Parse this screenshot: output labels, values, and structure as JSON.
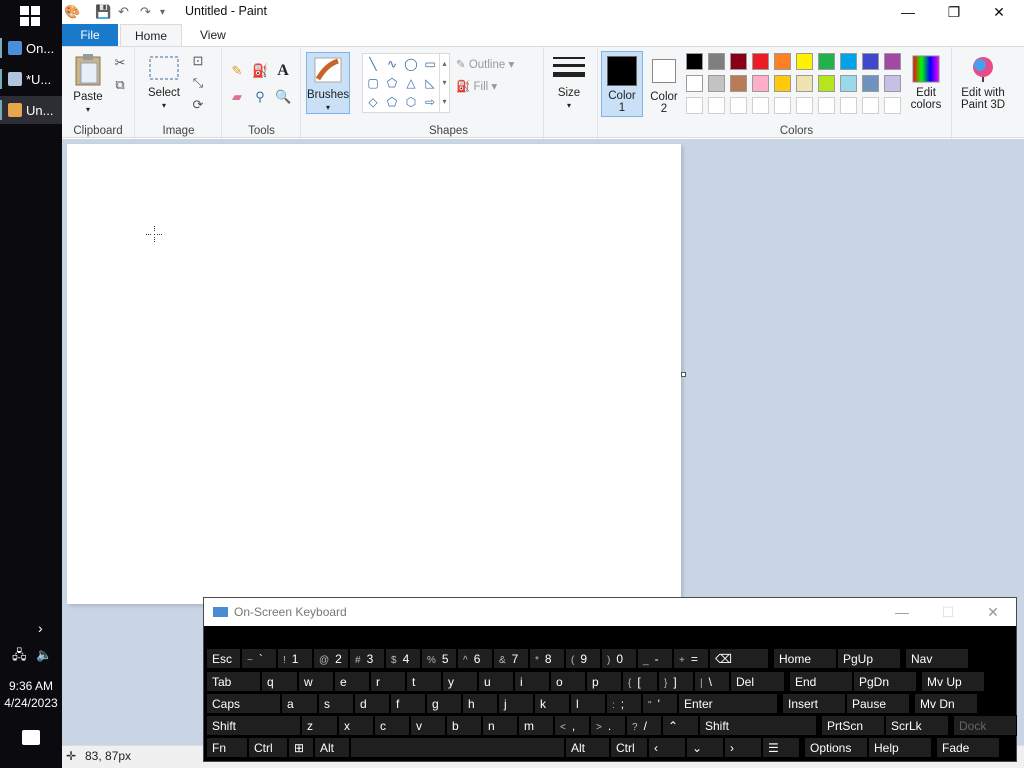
{
  "taskbar": {
    "items": [
      {
        "label": "On...",
        "color": "#4a90d9"
      },
      {
        "label": "*U...",
        "color": "#b0c4de"
      },
      {
        "label": "Un...",
        "color": "#e8a64a"
      }
    ],
    "time": "9:36 AM",
    "date": "4/24/2023"
  },
  "titlebar": {
    "title": "Untitled - Paint",
    "minimize": "—",
    "maximize": "❐",
    "close": "✕"
  },
  "tabs": {
    "file": "File",
    "home": "Home",
    "view": "View"
  },
  "ribbon": {
    "clipboard": {
      "label": "Clipboard",
      "paste": "Paste"
    },
    "image": {
      "label": "Image",
      "select": "Select"
    },
    "tools": {
      "label": "Tools"
    },
    "brushes": "Brushes",
    "shapes": {
      "label": "Shapes",
      "outline": "Outline",
      "fill": "Fill"
    },
    "size": "Size",
    "color1": {
      "line1": "Color",
      "line2": "1",
      "value": "#000000"
    },
    "color2": {
      "line1": "Color",
      "line2": "2",
      "value": "#ffffff"
    },
    "colors_label": "Colors",
    "edit_colors": {
      "line1": "Edit",
      "line2": "colors"
    },
    "paint3d": {
      "line1": "Edit with",
      "line2": "Paint 3D"
    },
    "palette_row1": [
      "#000000",
      "#7f7f7f",
      "#880015",
      "#ed1c24",
      "#ff7f27",
      "#fff200",
      "#22b14c",
      "#00a2e8",
      "#3f48cc",
      "#a349a4"
    ],
    "palette_row2": [
      "#ffffff",
      "#c3c3c3",
      "#b97a57",
      "#ffaec9",
      "#ffc90e",
      "#efe4b0",
      "#b5e61d",
      "#99d9ea",
      "#7092be",
      "#c8bfe7"
    ]
  },
  "status": {
    "cursor_pos": "83, 87px"
  },
  "osk": {
    "title": "On-Screen Keyboard",
    "rows": [
      [
        {
          "k": "Esc"
        },
        {
          "s": "~",
          "k": "`"
        },
        {
          "s": "!",
          "k": "1"
        },
        {
          "s": "@",
          "k": "2"
        },
        {
          "s": "#",
          "k": "3"
        },
        {
          "s": "$",
          "k": "4"
        },
        {
          "s": "%",
          "k": "5"
        },
        {
          "s": "^",
          "k": "6"
        },
        {
          "s": "&",
          "k": "7"
        },
        {
          "s": "*",
          "k": "8"
        },
        {
          "s": "(",
          "k": "9"
        },
        {
          "s": ")",
          "k": "0"
        },
        {
          "s": "_",
          "k": "-"
        },
        {
          "s": "+",
          "k": "="
        },
        {
          "k": "⌫"
        },
        {
          "k": "Home"
        },
        {
          "k": "PgUp"
        },
        {
          "k": "Nav"
        }
      ],
      [
        {
          "k": "Tab"
        },
        {
          "k": "q"
        },
        {
          "k": "w"
        },
        {
          "k": "e"
        },
        {
          "k": "r"
        },
        {
          "k": "t"
        },
        {
          "k": "y"
        },
        {
          "k": "u"
        },
        {
          "k": "i"
        },
        {
          "k": "o"
        },
        {
          "k": "p"
        },
        {
          "s": "{",
          "k": "["
        },
        {
          "s": "}",
          "k": "]"
        },
        {
          "s": "|",
          "k": "\\"
        },
        {
          "k": "Del"
        },
        {
          "k": "End"
        },
        {
          "k": "PgDn"
        },
        {
          "k": "Mv Up"
        }
      ],
      [
        {
          "k": "Caps"
        },
        {
          "k": "a"
        },
        {
          "k": "s"
        },
        {
          "k": "d"
        },
        {
          "k": "f"
        },
        {
          "k": "g"
        },
        {
          "k": "h"
        },
        {
          "k": "j"
        },
        {
          "k": "k"
        },
        {
          "k": "l"
        },
        {
          "s": ":",
          "k": ";"
        },
        {
          "s": "\"",
          "k": "'"
        },
        {
          "k": "Enter"
        },
        {
          "k": "Insert"
        },
        {
          "k": "Pause"
        },
        {
          "k": "Mv Dn"
        }
      ],
      [
        {
          "k": "Shift"
        },
        {
          "k": "z"
        },
        {
          "k": "x"
        },
        {
          "k": "c"
        },
        {
          "k": "v"
        },
        {
          "k": "b"
        },
        {
          "k": "n"
        },
        {
          "k": "m"
        },
        {
          "s": "<",
          "k": ","
        },
        {
          "s": ">",
          "k": "."
        },
        {
          "s": "?",
          "k": "/"
        },
        {
          "k": "⌃"
        },
        {
          "k": "Shift"
        },
        {
          "k": "PrtScn"
        },
        {
          "k": "ScrLk"
        },
        {
          "k": "Dock"
        }
      ],
      [
        {
          "k": "Fn"
        },
        {
          "k": "Ctrl"
        },
        {
          "k": "⊞"
        },
        {
          "k": "Alt"
        },
        {
          "k": ""
        },
        {
          "k": "Alt"
        },
        {
          "k": "Ctrl"
        },
        {
          "k": "‹"
        },
        {
          "k": "⌄"
        },
        {
          "k": "›"
        },
        {
          "k": "☰"
        },
        {
          "k": "Options"
        },
        {
          "k": "Help"
        },
        {
          "k": "Fade"
        }
      ]
    ]
  }
}
